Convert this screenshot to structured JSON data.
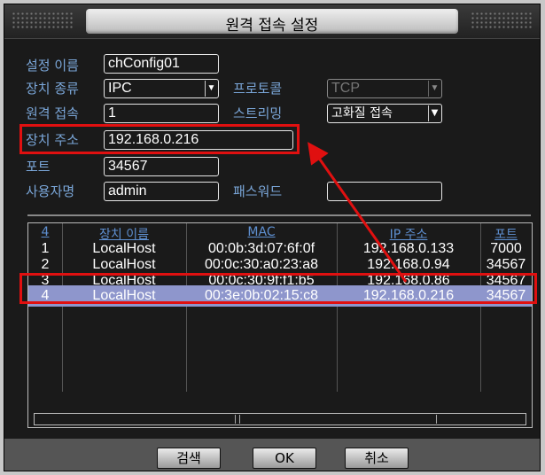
{
  "window": {
    "title": "원격 접속 설정"
  },
  "form": {
    "config_name": {
      "label": "설정 이름",
      "value": "chConfig01"
    },
    "device_type": {
      "label": "장치 종류",
      "value": "IPC"
    },
    "protocol": {
      "label": "프로토콜",
      "value": "TCP"
    },
    "remote_channel": {
      "label": "원격 접속",
      "value": "1"
    },
    "streaming": {
      "label": "스트리밍",
      "value": "고화질 접속"
    },
    "device_address": {
      "label": "장치 주소",
      "value": "192.168.0.216"
    },
    "port": {
      "label": "포트",
      "value": "34567"
    },
    "username": {
      "label": "사용자명",
      "value": "admin"
    },
    "password": {
      "label": "패스워드",
      "value": ""
    }
  },
  "device_list": {
    "headers": {
      "count": "4",
      "name": "장치 이름",
      "mac": "MAC",
      "ip": "IP 주소",
      "port": "포트"
    },
    "rows": [
      {
        "no": "1",
        "name": "LocalHost",
        "mac": "00:0b:3d:07:6f:0f",
        "ip": "192.168.0.133",
        "port": "7000"
      },
      {
        "no": "2",
        "name": "LocalHost",
        "mac": "00:0c:30:a0:23:a8",
        "ip": "192.168.0.94",
        "port": "34567"
      },
      {
        "no": "3",
        "name": "LocalHost",
        "mac": "00:0c:30:9f:f1:b5",
        "ip": "192.168.0.86",
        "port": "34567"
      },
      {
        "no": "4",
        "name": "LocalHost",
        "mac": "00:3e:0b:02:15:c8",
        "ip": "192.168.0.216",
        "port": "34567"
      }
    ]
  },
  "buttons": {
    "search": "검색",
    "ok": "OK",
    "cancel": "취소"
  },
  "colors": {
    "highlight": "#e01010",
    "selected_row": "#8e96cc",
    "label": "#7aa6d8"
  }
}
